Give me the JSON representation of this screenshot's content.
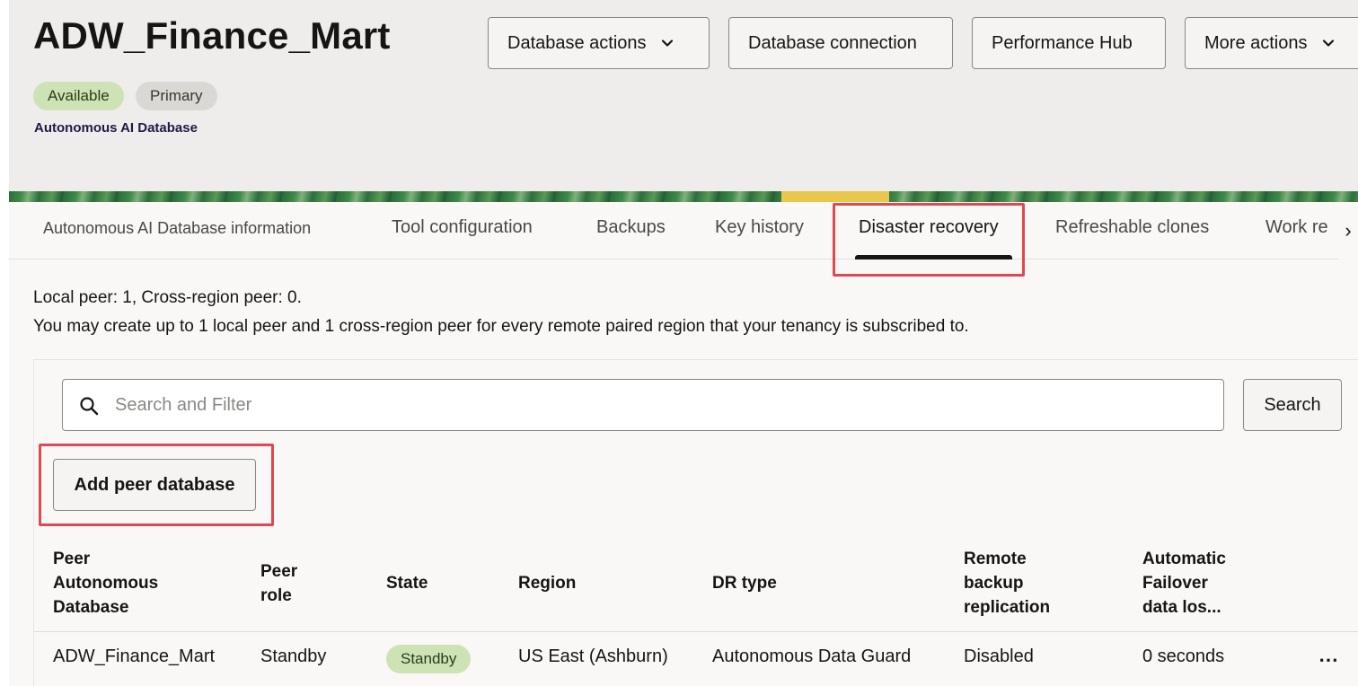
{
  "header": {
    "title": "ADW_Finance_Mart",
    "badges": {
      "available": "Available",
      "primary": "Primary"
    },
    "subtitle": "Autonomous AI Database",
    "buttons": {
      "database_actions": "Database actions",
      "database_connection": "Database connection",
      "performance_hub": "Performance Hub",
      "more_actions": "More actions"
    }
  },
  "tabs": [
    {
      "label": "Autonomous AI Database information"
    },
    {
      "label": "Tool configuration"
    },
    {
      "label": "Backups"
    },
    {
      "label": "Key history"
    },
    {
      "label": "Disaster recovery",
      "active": true
    },
    {
      "label": "Refreshable clones"
    },
    {
      "label": "Work re"
    }
  ],
  "body": {
    "peer_counts": "Local peer: 1, Cross-region peer: 0.",
    "peer_note": "You may create up to 1 local peer and 1 cross-region peer for every remote paired region that your tenancy is subscribed to.",
    "search": {
      "placeholder": "Search and Filter",
      "value": "",
      "button": "Search"
    },
    "add_button": "Add peer database"
  },
  "table": {
    "columns": [
      {
        "line1": "Peer",
        "line2": "Autonomous",
        "line3": "Database"
      },
      {
        "line1": "Peer",
        "line2": "role"
      },
      {
        "line1": "State"
      },
      {
        "line1": "Region"
      },
      {
        "line1": "DR type"
      },
      {
        "line1": "Remote",
        "line2": "backup",
        "line3": "replication"
      },
      {
        "line1": "Automatic",
        "line2": "Failover",
        "line3": "data los..."
      }
    ],
    "rows": [
      {
        "peer_db": "ADW_Finance_Mart",
        "role": "Standby",
        "state": "Standby",
        "region": "US East (Ashburn)",
        "dr_type": "Autonomous Data Guard",
        "backup_replication": "Disabled",
        "failover_loss": "0 seconds"
      }
    ]
  },
  "colors": {
    "accent_highlight": "#e0484f",
    "available_badge": "#cde3b5",
    "header_bg": "#eeedeb"
  }
}
